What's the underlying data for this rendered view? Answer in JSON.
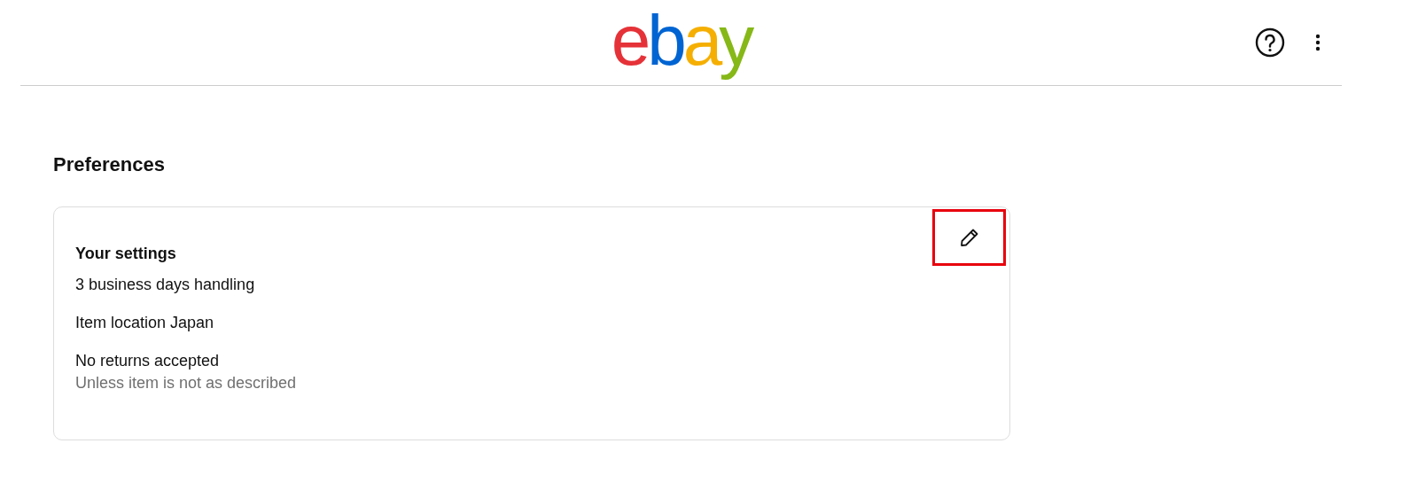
{
  "header": {
    "logo": [
      {
        "text": "e",
        "color": "#e53238"
      },
      {
        "text": "b",
        "color": "#0064d2"
      },
      {
        "text": "a",
        "color": "#f5af02"
      },
      {
        "text": "y",
        "color": "#86b817"
      }
    ]
  },
  "section_title": "Preferences",
  "card": {
    "title": "Your settings",
    "edit_button": {
      "highlighted": true
    },
    "items": [
      {
        "text": "3 business days handling"
      },
      {
        "text": "Item location Japan"
      },
      {
        "text": "No returns accepted",
        "note": "Unless item is not as described"
      }
    ]
  }
}
